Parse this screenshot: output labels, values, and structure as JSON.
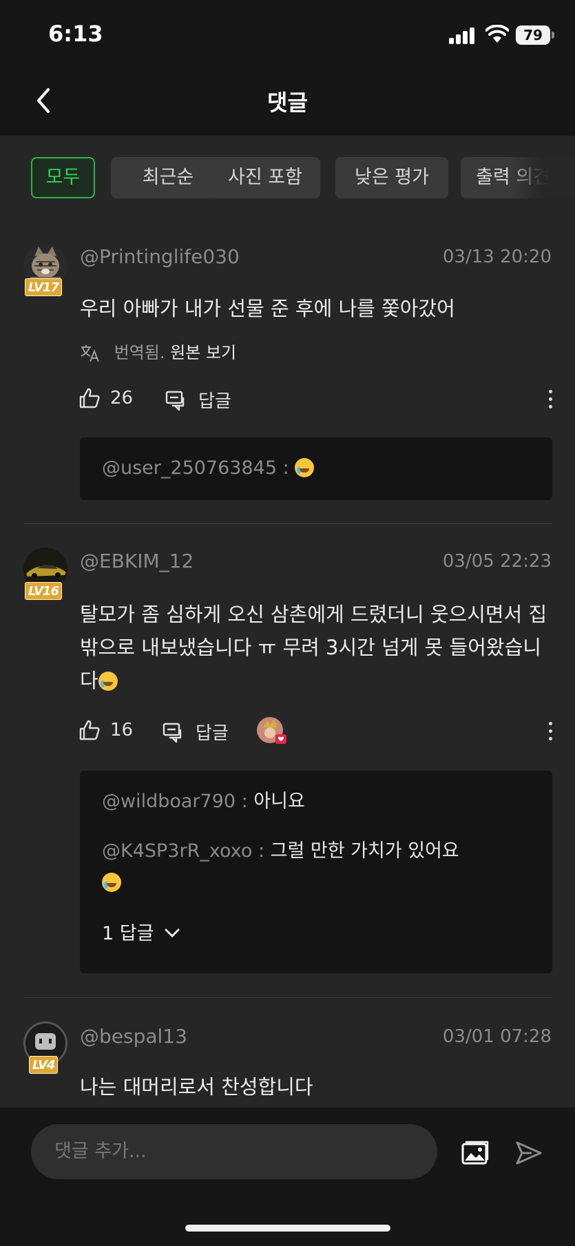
{
  "status_bar": {
    "time": "6:13",
    "battery": "79"
  },
  "header": {
    "title": "댓글"
  },
  "filters": [
    "모두",
    "최근순",
    "사진 포함",
    "낮은 평가",
    "출력 의견"
  ],
  "comments": [
    {
      "username": "@Printinglife030",
      "level": "LV17",
      "date": "03/13 20:20",
      "text": "우리 아빠가 내가 선물 준 후에 나를 쫓아갔어",
      "translated_label": "번역됨.",
      "original_link": "원본 보기",
      "likes": "26",
      "reply_label": "답글",
      "replies": [
        {
          "handle": "@user_250763845",
          "sep": " : ",
          "text": ""
        }
      ]
    },
    {
      "username": "@EBKIM_12",
      "level": "LV16",
      "date": "03/05 22:23",
      "text": "탈모가 좀 심하게 오신 삼촌에게 드렸더니 웃으시면서 집 밖으로 내보냈습니다 ㅠ 무려 3시간 넘게 못 들어왔습니다",
      "likes": "16",
      "reply_label": "답글",
      "replies": [
        {
          "handle": "@wildboar790",
          "sep": " : ",
          "text": "아니요"
        },
        {
          "handle": "@K4SP3rR_xoxo",
          "sep": " : ",
          "text": "그럴 만한 가치가 있어요"
        }
      ],
      "more_replies": "1 답글"
    },
    {
      "username": "@bespal13",
      "level": "LV4",
      "date": "03/01 07:28",
      "text": "나는 대머리로서 찬성합니다"
    }
  ],
  "composer": {
    "placeholder": "댓글 추가..."
  },
  "icons": [
    "back-icon",
    "translate-icon",
    "like-icon",
    "reply-icon",
    "more-icon",
    "chevron-down-icon",
    "image-icon",
    "send-icon"
  ],
  "colors": {
    "accent": "#2fb24c",
    "background": "#262626",
    "level_badge": "#e0a735"
  }
}
